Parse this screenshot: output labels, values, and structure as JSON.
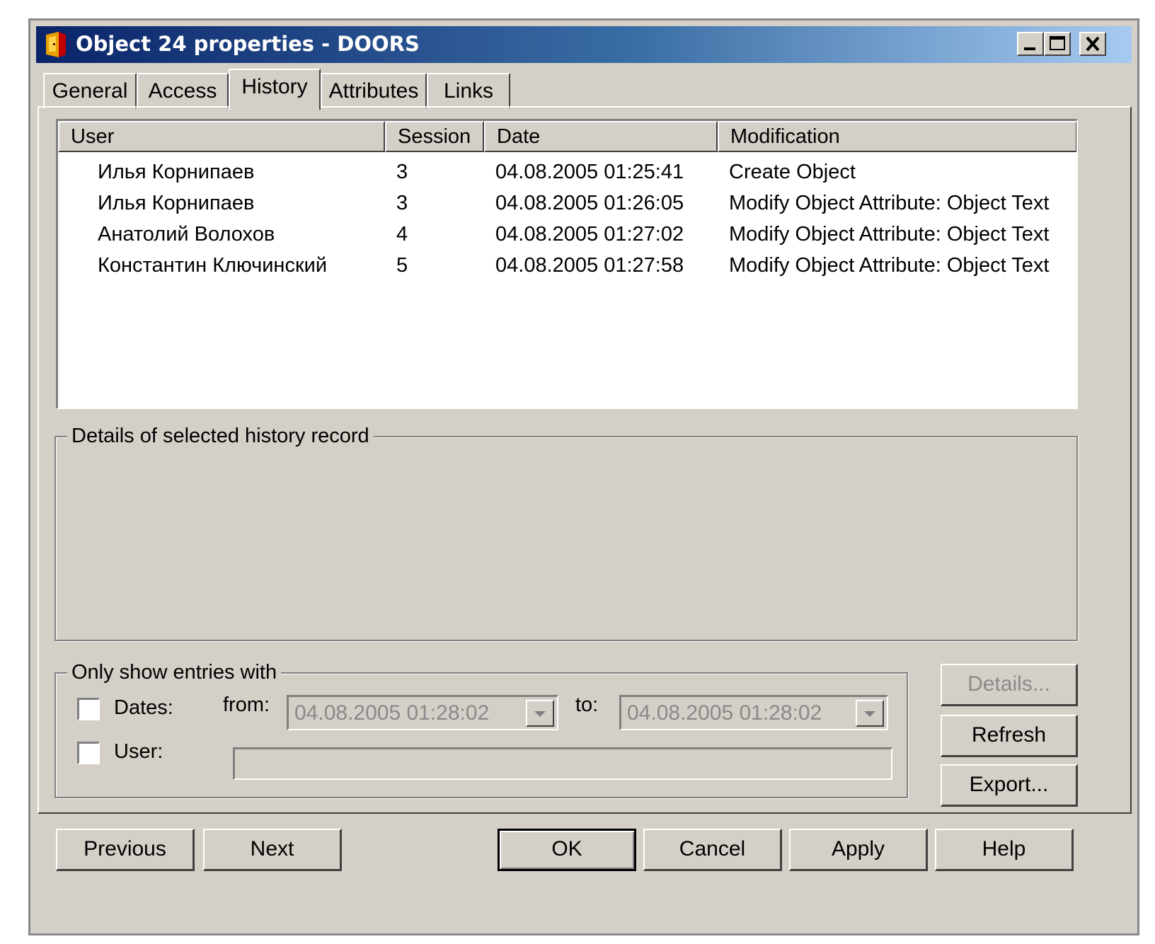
{
  "window": {
    "title": "Object 24 properties - DOORS"
  },
  "tabs": [
    {
      "label": "General"
    },
    {
      "label": "Access"
    },
    {
      "label": "History"
    },
    {
      "label": "Attributes"
    },
    {
      "label": "Links"
    }
  ],
  "history": {
    "columns": [
      "User",
      "Session",
      "Date",
      "Modification"
    ],
    "rows": [
      {
        "user": "Илья Корнипаев",
        "session": "3",
        "date": "04.08.2005 01:25:41",
        "modification": "Create Object"
      },
      {
        "user": "Илья Корнипаев",
        "session": "3",
        "date": "04.08.2005 01:26:05",
        "modification": "Modify Object Attribute: Object Text"
      },
      {
        "user": "Анатолий Волохов",
        "session": "4",
        "date": "04.08.2005 01:27:02",
        "modification": "Modify Object Attribute: Object Text"
      },
      {
        "user": "Константин Ключинский",
        "session": "5",
        "date": "04.08.2005 01:27:58",
        "modification": "Modify Object Attribute: Object Text"
      }
    ]
  },
  "details": {
    "label": "Details of selected history record"
  },
  "filter": {
    "label": "Only show entries with",
    "dates_label": "Dates:",
    "dates_checked": false,
    "from_label": "from:",
    "from_value": "04.08.2005 01:28:02",
    "to_label": "to:",
    "to_value": "04.08.2005 01:28:02",
    "user_label": "User:",
    "user_checked": false,
    "user_value": ""
  },
  "side_buttons": {
    "details": "Details...",
    "refresh": "Refresh",
    "export": "Export..."
  },
  "bottom_buttons": {
    "previous": "Previous",
    "next": "Next",
    "ok": "OK",
    "cancel": "Cancel",
    "apply": "Apply",
    "help": "Help"
  }
}
